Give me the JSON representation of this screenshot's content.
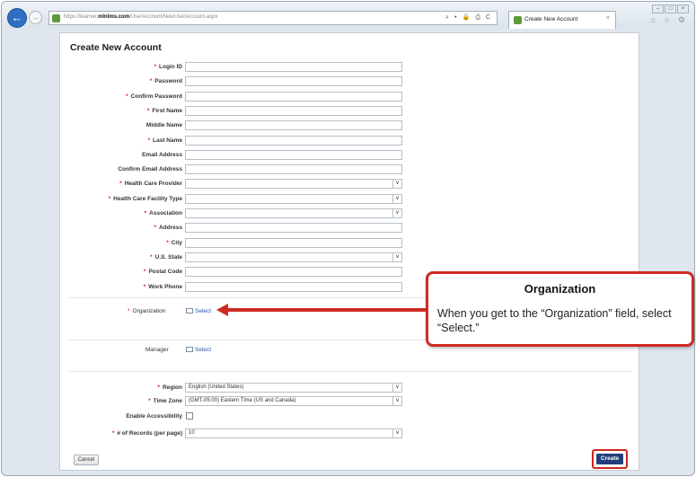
{
  "browser": {
    "url_prefix": "https://learner.",
    "url_domain": "mlnlms.com",
    "url_path": "/UserAccount/NewUserAccount.aspx",
    "address_icons": "⌕ ▾ 🔒 ⎙ C",
    "tab_title": "Create New Account",
    "tab_close": "×",
    "window_buttons": [
      "–",
      "□",
      "×"
    ],
    "toolbar_icons": "⌂ ☆ ⚙"
  },
  "form": {
    "title": "Create New Account",
    "required_marker": "*",
    "fields": [
      {
        "label": "Login ID",
        "required": true,
        "type": "text",
        "value": ""
      },
      {
        "label": "Password",
        "required": true,
        "type": "text",
        "value": ""
      },
      {
        "label": "Confirm Password",
        "required": true,
        "type": "text",
        "value": ""
      },
      {
        "label": "First Name",
        "required": true,
        "type": "text",
        "value": ""
      },
      {
        "label": "Middle Name",
        "required": false,
        "type": "text",
        "value": ""
      },
      {
        "label": "Last Name",
        "required": true,
        "type": "text",
        "value": ""
      },
      {
        "label": "Email Address",
        "required": false,
        "type": "text",
        "value": ""
      },
      {
        "label": "Confirm Email Address",
        "required": false,
        "type": "text",
        "value": ""
      },
      {
        "label": "Health Care Provider",
        "required": true,
        "type": "select",
        "value": ""
      },
      {
        "label": "Health Care Facility Type",
        "required": true,
        "type": "select",
        "value": ""
      },
      {
        "label": "Association",
        "required": true,
        "type": "select",
        "value": ""
      },
      {
        "label": "Address",
        "required": true,
        "type": "text",
        "value": ""
      },
      {
        "label": "City",
        "required": true,
        "type": "text",
        "value": ""
      },
      {
        "label": "U.S. State",
        "required": true,
        "type": "select",
        "value": ""
      },
      {
        "label": "Postal Code",
        "required": true,
        "type": "text",
        "value": ""
      },
      {
        "label": "Work Phone",
        "required": true,
        "type": "text",
        "value": ""
      }
    ],
    "organization": {
      "label": "Organization",
      "link": "Select"
    },
    "manager": {
      "label": "Manager",
      "link": "Select"
    },
    "region": {
      "label": "Region",
      "value": "English (United States)"
    },
    "time_zone": {
      "label": "Time Zone",
      "value": "(GMT-05:00) Eastern Time (US and Canada)"
    },
    "accessibility": {
      "label": "Enable Accessibility"
    },
    "records_per_page": {
      "label": "# of Records (per page)",
      "value": "10"
    },
    "cancel_label": "Cancel",
    "create_label": "Create",
    "select_arrow": "∨"
  },
  "callout": {
    "title": "Organization",
    "body": "When you get to the “Organization” field, select “Select.”"
  },
  "colors": {
    "required": "#d0261c",
    "callout_border": "#cf2a22",
    "create_button": "#24407a",
    "link": "#2a56a8"
  }
}
